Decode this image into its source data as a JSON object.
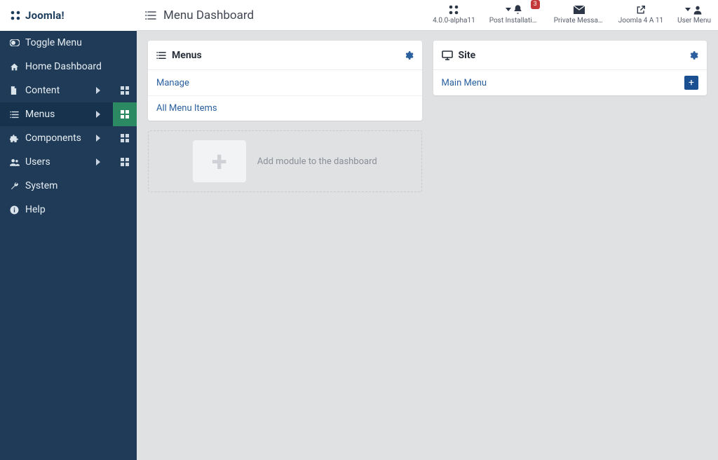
{
  "brand": "Joomla!",
  "page_title": "Menu Dashboard",
  "header_items": [
    {
      "id": "version-info",
      "icon": "joomla",
      "label": "4.0.0-alpha11",
      "caret": false
    },
    {
      "id": "post-install",
      "icon": "bell",
      "label": "Post Installation ...",
      "caret": true,
      "badge": "3"
    },
    {
      "id": "private-msgs",
      "icon": "mail",
      "label": "Private Messages",
      "caret": false
    },
    {
      "id": "site-link",
      "icon": "ext",
      "label": "Joomla 4 A 11",
      "caret": false
    },
    {
      "id": "user-menu",
      "icon": "user",
      "label": "User Menu",
      "caret": true
    }
  ],
  "sidebar": [
    {
      "id": "toggle-menu",
      "icon": "toggle",
      "label": "Toggle Menu"
    },
    {
      "id": "home-dash",
      "icon": "home",
      "label": "Home Dashboard"
    },
    {
      "id": "content",
      "icon": "file",
      "label": "Content",
      "expandable": true,
      "has_dash": true
    },
    {
      "id": "menus",
      "icon": "list",
      "label": "Menus",
      "expandable": true,
      "has_dash": true,
      "active": true
    },
    {
      "id": "components",
      "icon": "puzzle",
      "label": "Components",
      "expandable": true,
      "has_dash": true
    },
    {
      "id": "users",
      "icon": "users",
      "label": "Users",
      "expandable": true,
      "has_dash": true
    },
    {
      "id": "system",
      "icon": "wrench",
      "label": "System"
    },
    {
      "id": "help",
      "icon": "info",
      "label": "Help"
    }
  ],
  "card_menus": {
    "title": "Menus",
    "rows": [
      {
        "id": "manage",
        "label": "Manage"
      },
      {
        "id": "all-items",
        "label": "All Menu Items"
      }
    ]
  },
  "card_site": {
    "title": "Site",
    "rows": [
      {
        "id": "main-menu",
        "label": "Main Menu",
        "has_add": true
      }
    ]
  },
  "add_module_label": "Add module to the dashboard"
}
